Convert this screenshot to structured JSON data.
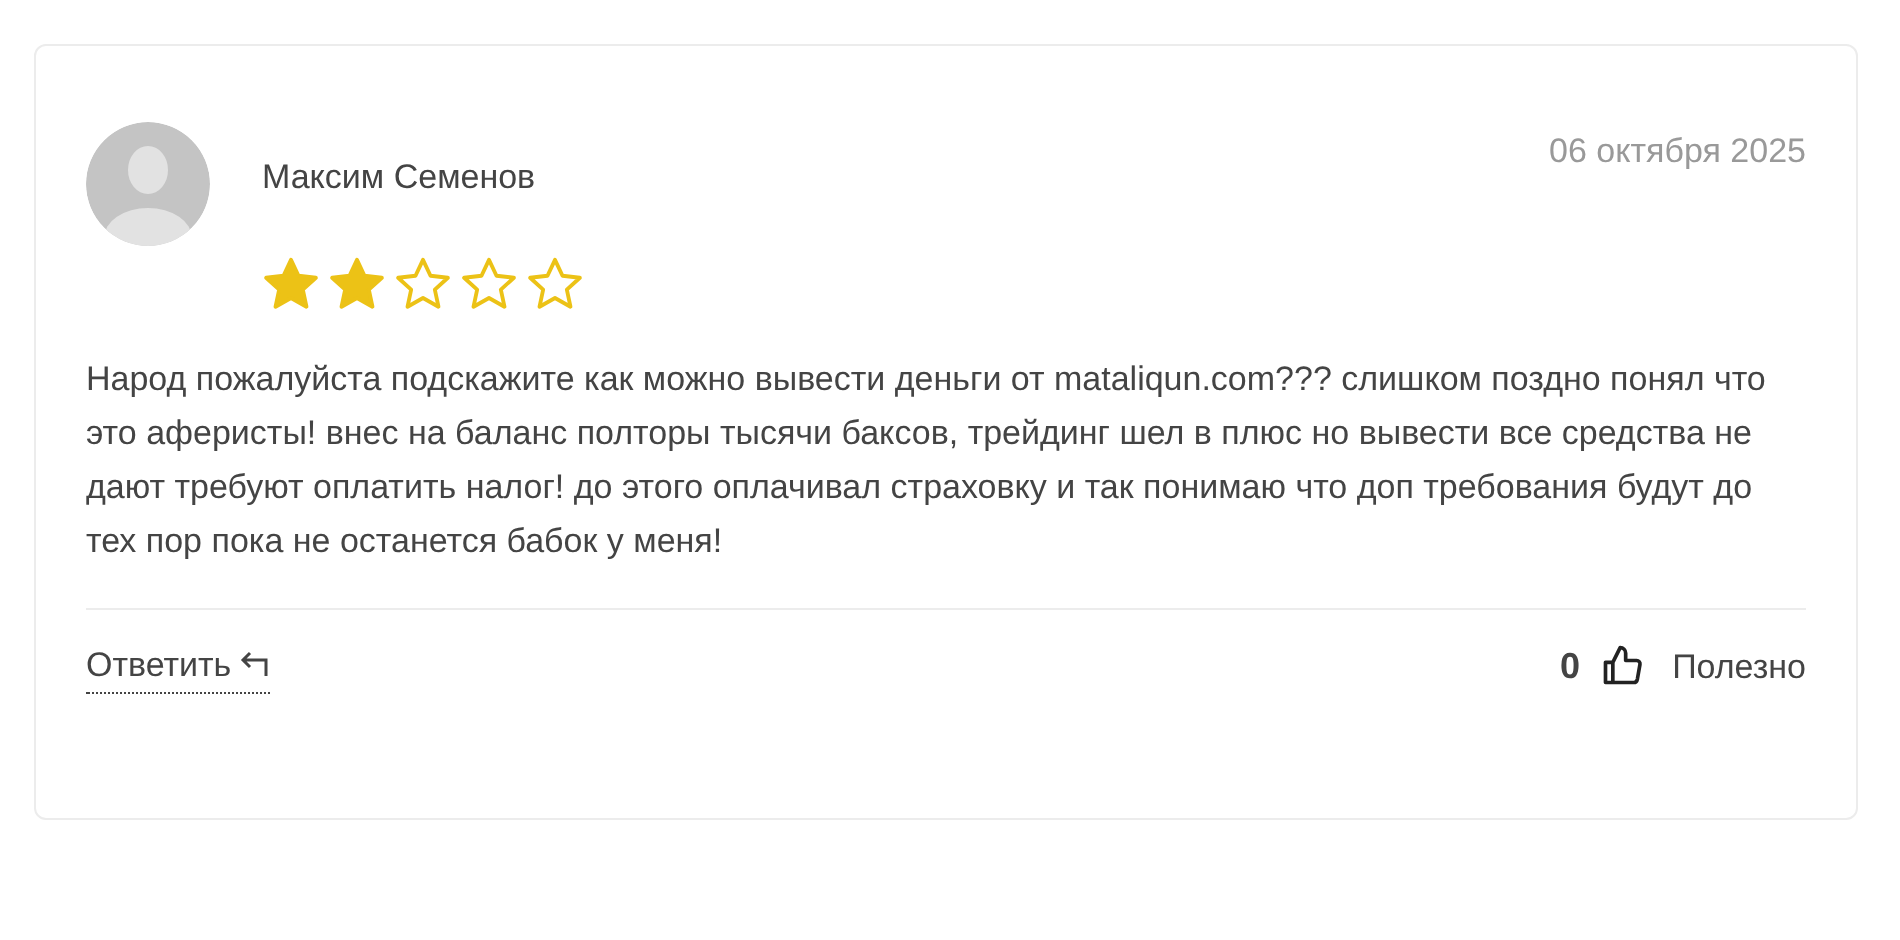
{
  "review": {
    "author": "Максим Семенов",
    "date": "06 октября 2025",
    "stars": 2,
    "text": "Народ пожалуйста подскажите как можно вывести деньги от mataliqun.com??? слишком поздно понял что это аферисты! внес на баланс полторы тысячи баксов, трейдинг шел в плюс но вывести все средства не дают требуют оплатить налог! до этого оплачивал страховку и так понимаю что доп требования будут до тех пор пока не останется бабок у меня!",
    "reply_link": "Ответить",
    "likes": "0",
    "helpful": "Полезно"
  }
}
